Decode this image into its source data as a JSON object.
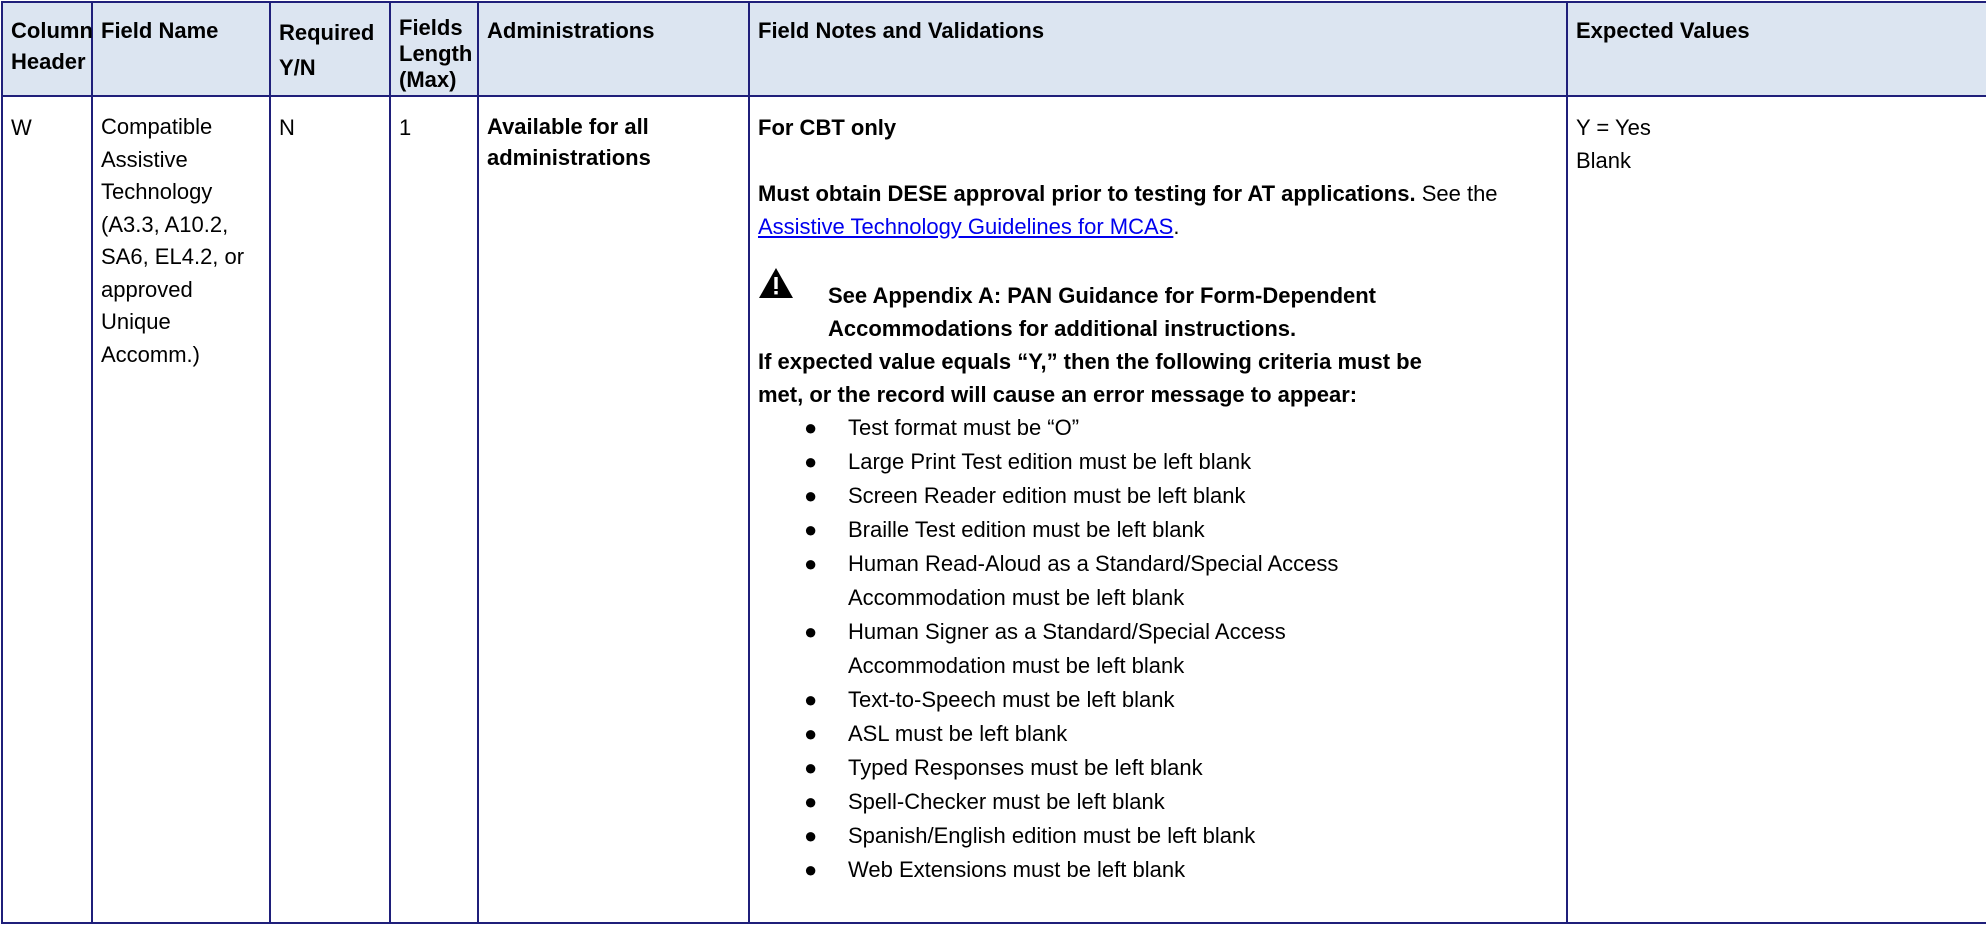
{
  "headers": {
    "column_header": "Column Header",
    "field_name": "Field Name",
    "required": "Required Y/N",
    "length": "Fields Length (Max)",
    "administrations": "Administrations",
    "notes": "Field Notes and Validations",
    "expected": "Expected Values"
  },
  "row": {
    "column": "W",
    "field_name": "Compatible Assistive Technology (A3.3, A10.2, SA6, EL4.2, or approved Unique Accomm.)",
    "required": "N",
    "length": "1",
    "administrations": "Available for all administrations",
    "notes": {
      "cbt_only": "For CBT only",
      "approval_bold": "Must obtain DESE approval prior to testing for AT applications.",
      "see_the": " See the",
      "guidelines_link": "Assistive Technology Guidelines for MCAS",
      "period": ".",
      "warning_icon": "warning-triangle-icon",
      "appendix_note": "See Appendix A: PAN Guidance for Form-Dependent Accommodations for additional instructions.",
      "criteria_intro": "If expected value equals “Y,” then the following criteria must be met, or the record will cause an error message to appear:",
      "criteria": [
        "Test format must be “O”",
        "Large Print Test edition must be left blank",
        "Screen Reader edition must be left blank",
        "Braille Test edition must be left blank",
        "Human Read-Aloud as a Standard/Special Access Accommodation must be left blank",
        "Human Signer as a Standard/Special Access Accommodation must be left blank",
        "Text-to-Speech must be left blank",
        "ASL must be left blank",
        "Typed Responses must be left blank",
        "Spell-Checker must be left blank",
        "Spanish/English edition must be left blank",
        "Web Extensions must be left blank"
      ]
    },
    "expected": [
      "Y = Yes",
      "Blank"
    ]
  },
  "colors": {
    "border": "#1f1f7a",
    "header_bg": "#dce5f1",
    "link": "#0000ee"
  }
}
